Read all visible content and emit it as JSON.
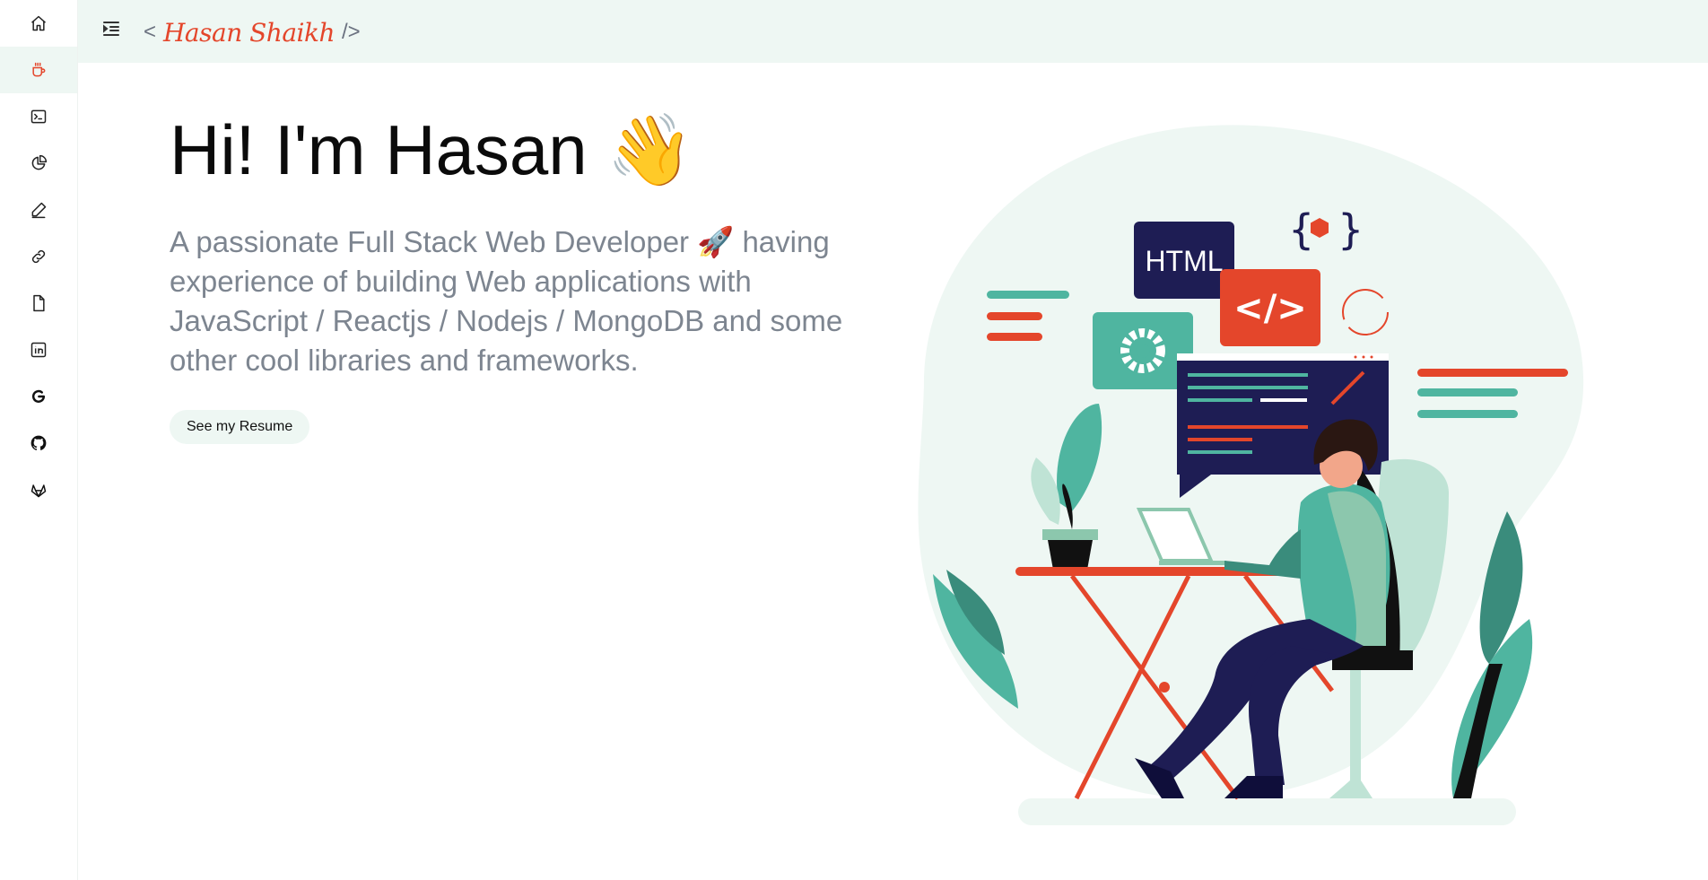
{
  "brand": {
    "open": "<",
    "signature": "Hasan Shaikh",
    "close": "/>"
  },
  "nav": {
    "items": [
      {
        "icon": "home-icon",
        "active": false
      },
      {
        "icon": "coffee-cup-icon",
        "active": true
      },
      {
        "icon": "terminal-icon",
        "active": false
      },
      {
        "icon": "pie-chart-icon",
        "active": false
      },
      {
        "icon": "pencil-icon",
        "active": false
      },
      {
        "icon": "link-icon",
        "active": false
      },
      {
        "icon": "file-icon",
        "active": false
      },
      {
        "icon": "linkedin-icon",
        "active": false
      },
      {
        "icon": "google-icon",
        "active": false
      },
      {
        "icon": "github-icon",
        "active": false
      },
      {
        "icon": "gitlab-icon",
        "active": false
      }
    ]
  },
  "hero": {
    "title": "Hi! I'm Hasan 👋",
    "description": "A passionate Full Stack Web Developer 🚀 having experience of building Web applications with JavaScript / Reactjs / Nodejs / MongoDB and some other cool libraries and frameworks.",
    "button_label": "See my Resume"
  },
  "illustration": {
    "html_label": "HTML",
    "code_label": "</>"
  },
  "colors": {
    "accent": "#e4462b",
    "teal": "#4fb5a0",
    "navy": "#1e1d54",
    "mint_bg": "#eef7f3",
    "text_muted": "#7d8590"
  }
}
